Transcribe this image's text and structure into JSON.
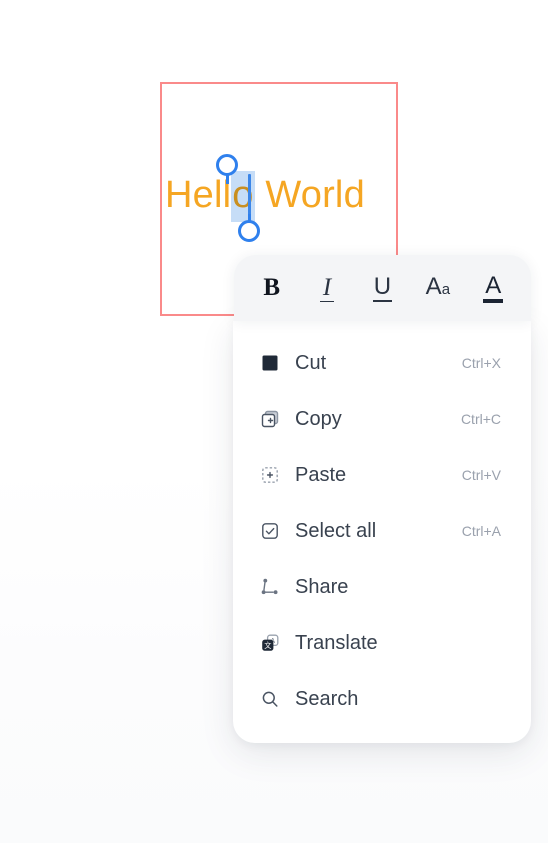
{
  "canvas": {
    "text_content": "Hello World",
    "text_before_selection": "Hell",
    "selected_text": "o",
    "text_after_selection": " World",
    "text_color": "#f5a623",
    "selection_color": "#2f80ed",
    "selection_rect_color": "#fa8a8a",
    "background_color": "#ffffff"
  },
  "format_toolbar": {
    "background_color": "#f4f5f7",
    "items": [
      {
        "id": "bold",
        "icon": "bold-icon",
        "label": "B"
      },
      {
        "id": "italic",
        "icon": "italic-icon",
        "label": "I"
      },
      {
        "id": "underline",
        "icon": "underline-icon",
        "label": "U"
      },
      {
        "id": "font-size",
        "icon": "font-size-icon",
        "label_big": "A",
        "label_small": "a"
      },
      {
        "id": "text-color",
        "icon": "text-color-icon",
        "label": "A"
      }
    ]
  },
  "context_menu": {
    "background_color": "#ffffff",
    "items": [
      {
        "id": "cut",
        "icon": "cut-icon",
        "label": "Cut",
        "shortcut": "Ctrl+X"
      },
      {
        "id": "copy",
        "icon": "copy-icon",
        "label": "Copy",
        "shortcut": "Ctrl+C"
      },
      {
        "id": "paste",
        "icon": "paste-icon",
        "label": "Paste",
        "shortcut": "Ctrl+V"
      },
      {
        "id": "select-all",
        "icon": "select-all-icon",
        "label": "Select all",
        "shortcut": "Ctrl+A"
      },
      {
        "id": "share",
        "icon": "share-icon",
        "label": "Share",
        "shortcut": ""
      },
      {
        "id": "translate",
        "icon": "translate-icon",
        "label": "Translate",
        "shortcut": ""
      },
      {
        "id": "search",
        "icon": "search-icon",
        "label": "Search",
        "shortcut": ""
      }
    ]
  }
}
